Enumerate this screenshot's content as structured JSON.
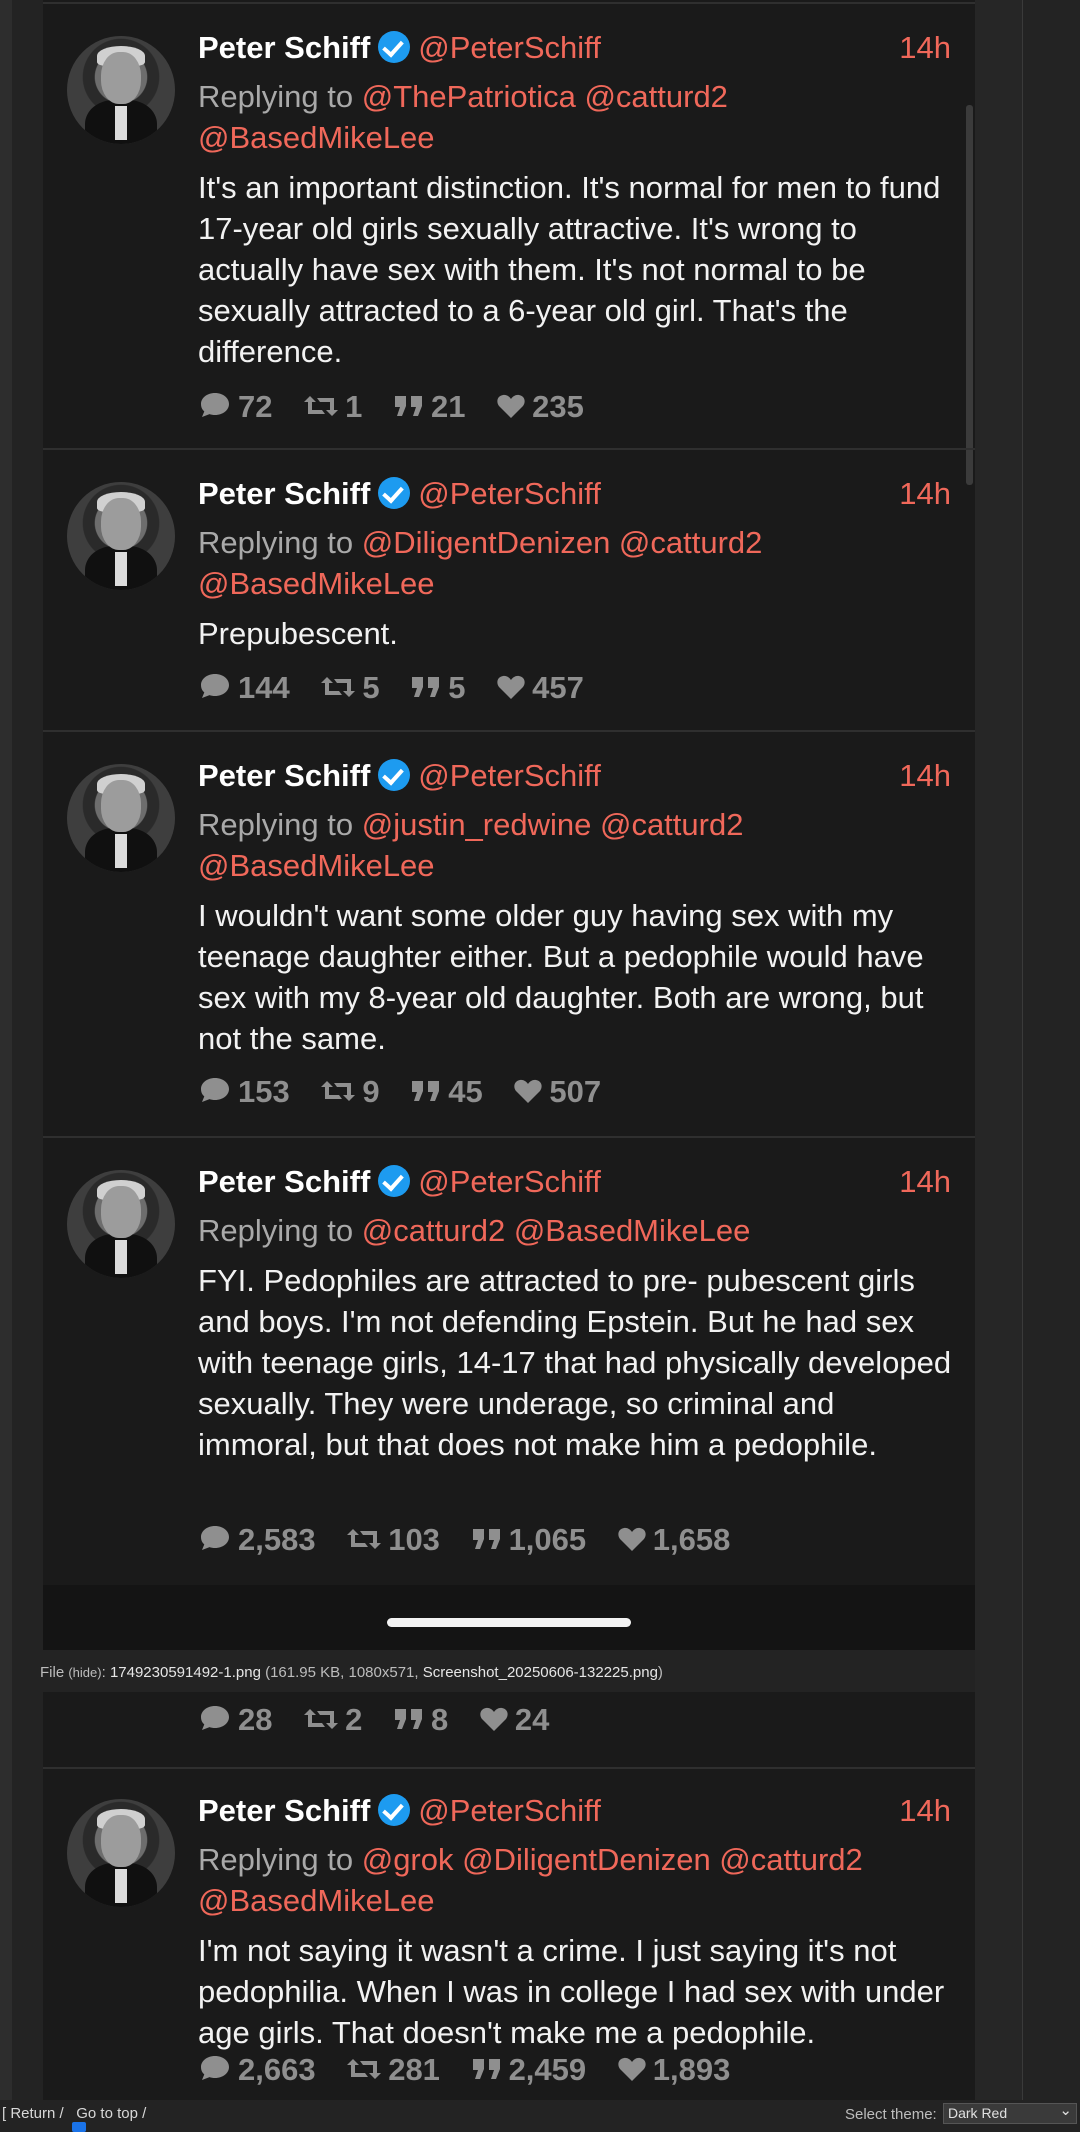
{
  "tweets": [
    {
      "name": "Peter Schiff",
      "handle": "@PeterSchiff",
      "time": "14h",
      "replying_prefix": "Replying to",
      "mentions_line1": "@ThePatriotica @catturd2",
      "mentions_line2": "@BasedMikeLee",
      "body": "It's an important distinction. It's normal for men to fund 17-year old girls sexually attractive.  It's wrong to actually have sex with them. It's not normal to be sexually attracted to a 6-year old girl.  That's the difference.",
      "replies": "72",
      "retweets": "1",
      "quotes": "21",
      "likes": "235"
    },
    {
      "name": "Peter Schiff",
      "handle": "@PeterSchiff",
      "time": "14h",
      "replying_prefix": "Replying to",
      "mentions_line1": "@DiligentDenizen @catturd2",
      "mentions_line2": "@BasedMikeLee",
      "body": "Prepubescent.",
      "replies": "144",
      "retweets": "5",
      "quotes": "5",
      "likes": "457"
    },
    {
      "name": "Peter Schiff",
      "handle": "@PeterSchiff",
      "time": "14h",
      "replying_prefix": "Replying to",
      "mentions_line1": "@justin_redwine @catturd2",
      "mentions_line2": "@BasedMikeLee",
      "body": "I wouldn't want some older guy having sex with my teenage daughter either. But a pedophile would have sex with my 8-year old daughter. Both are wrong, but not the same.",
      "replies": "153",
      "retweets": "9",
      "quotes": "45",
      "likes": "507"
    },
    {
      "name": "Peter Schiff",
      "handle": "@PeterSchiff",
      "time": "14h",
      "replying_prefix": "Replying to",
      "mentions_line1": "@catturd2 @BasedMikeLee",
      "mentions_line2": "",
      "body": "FYI. Pedophiles are attracted to pre- pubescent girls and boys.  I'm not defending Epstein. But he had sex with teenage girls, 14-17 that had physically developed sexually. They were underage, so criminal and immoral, but that does not make him a pedophile.",
      "replies": "2,583",
      "retweets": "103",
      "quotes": "1,065",
      "likes": "1,658"
    }
  ],
  "file_info": {
    "label": "File",
    "hide": "(hide)",
    "filename": "1749230591492-1.png",
    "meta": "(161.95 KB, 1080x571, ",
    "original": "Screenshot_20250606-132225.png",
    "close": ")"
  },
  "second_shot": {
    "stats_top": {
      "replies": "28",
      "retweets": "2",
      "quotes": "8",
      "likes": "24"
    },
    "tweet": {
      "name": "Peter Schiff",
      "handle": "@PeterSchiff",
      "time": "14h",
      "replying_prefix": "Replying to",
      "mentions_line1": "@grok @DiligentDenizen @catturd2",
      "mentions_line2": "@BasedMikeLee",
      "body": "I'm not saying it wasn't a crime.  I just saying it's not pedophilia. When I was in college I had sex with under age girls. That doesn't make me a pedophile.",
      "replies": "2,663",
      "retweets": "281",
      "quotes": "2,459",
      "likes": "1,893"
    }
  },
  "bottom_bar": {
    "return": "[ Return /",
    "top": "Go to top /",
    "theme_label": "Select theme:",
    "theme_value": "Dark Red"
  },
  "colors": {
    "accent": "#f0685a",
    "verified": "#1d9bf0",
    "background": "#1a1a1a"
  }
}
